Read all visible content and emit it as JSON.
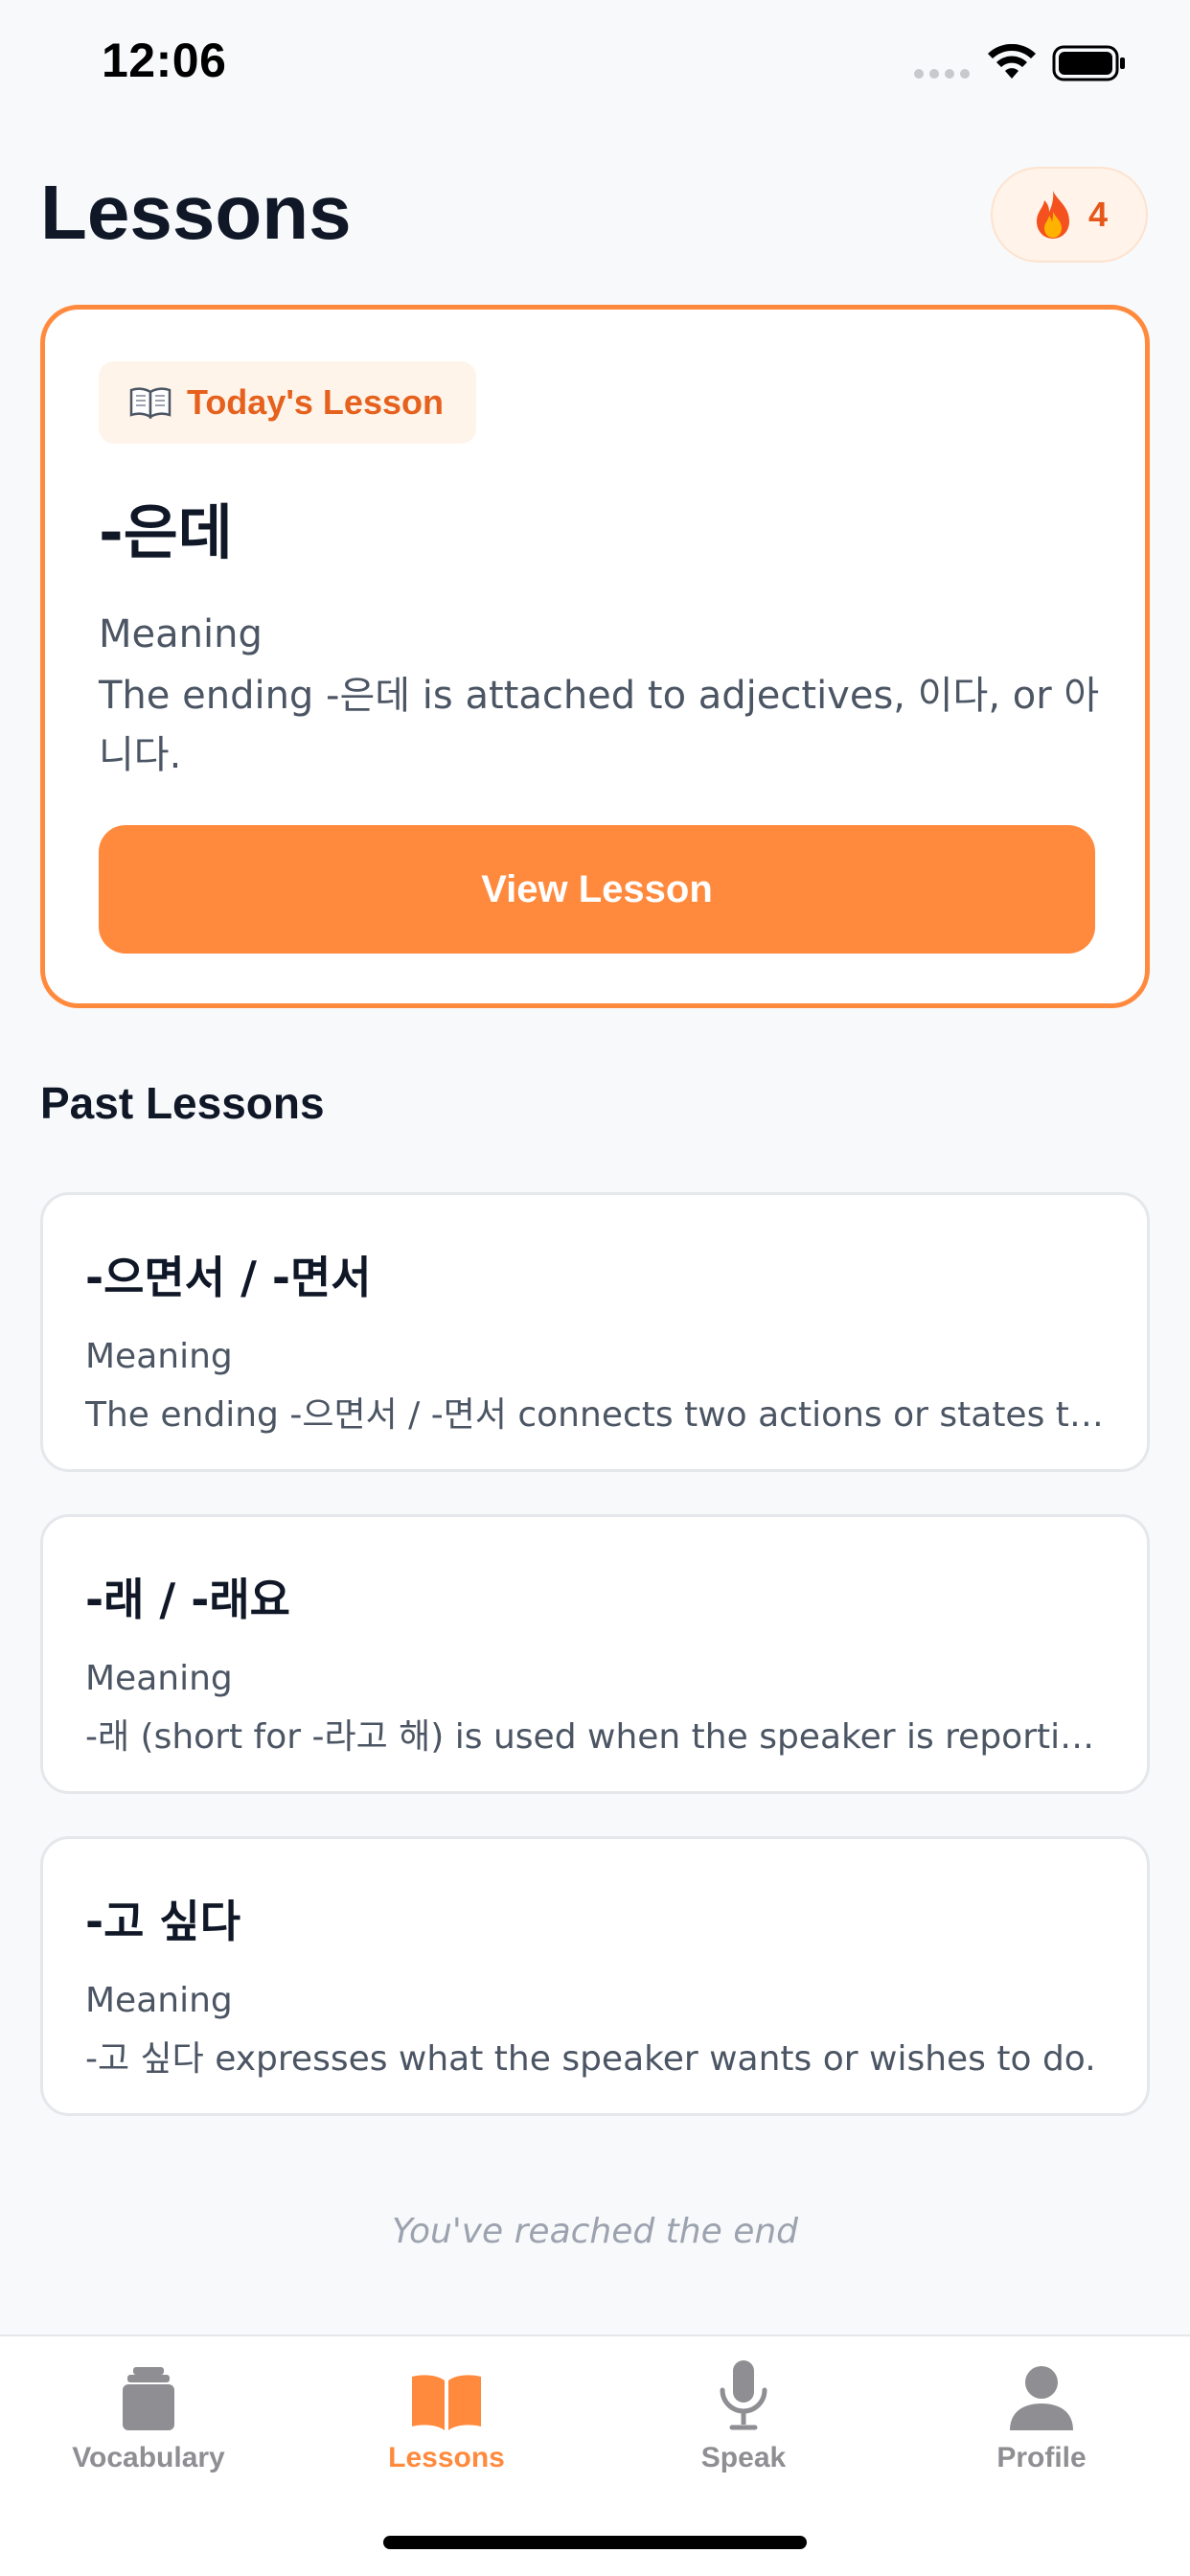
{
  "status_bar": {
    "time": "12:06"
  },
  "header": {
    "title": "Lessons",
    "streak": {
      "icon": "fire-icon",
      "count": "4"
    }
  },
  "today_lesson": {
    "badge_icon": "open-book-icon",
    "badge_label": "Today's Lesson",
    "title": "-은데",
    "meaning_label": "Meaning",
    "meaning_text": "The ending -은데 is attached to adjectives, 이다, or 아니다.",
    "button_label": "View Lesson"
  },
  "past_lessons": {
    "section_title": "Past Lessons",
    "items": [
      {
        "title": "-으면서 / -면서",
        "meaning_label": "Meaning",
        "meaning_text": "The ending -으면서 / -면서 connects two actions or states tha..."
      },
      {
        "title": "-래 / -래요",
        "meaning_label": "Meaning",
        "meaning_text": "-래 (short for -라고 해) is used when the speaker is reporting..."
      },
      {
        "title": "-고 싶다",
        "meaning_label": "Meaning",
        "meaning_text": "-고 싶다 expresses what the speaker wants or wishes to do."
      }
    ],
    "end_note": "You've reached the end"
  },
  "tab_bar": {
    "tabs": [
      {
        "label": "Vocabulary",
        "icon": "cards-stack-icon",
        "active": false
      },
      {
        "label": "Lessons",
        "icon": "open-book-icon",
        "active": true
      },
      {
        "label": "Speak",
        "icon": "microphone-icon",
        "active": false
      },
      {
        "label": "Profile",
        "icon": "person-icon",
        "active": false
      }
    ]
  },
  "colors": {
    "accent": "#ff8a3d",
    "accent_text": "#e5611d",
    "inactive_tab": "#8e8e93",
    "background": "#f8f9fb"
  }
}
